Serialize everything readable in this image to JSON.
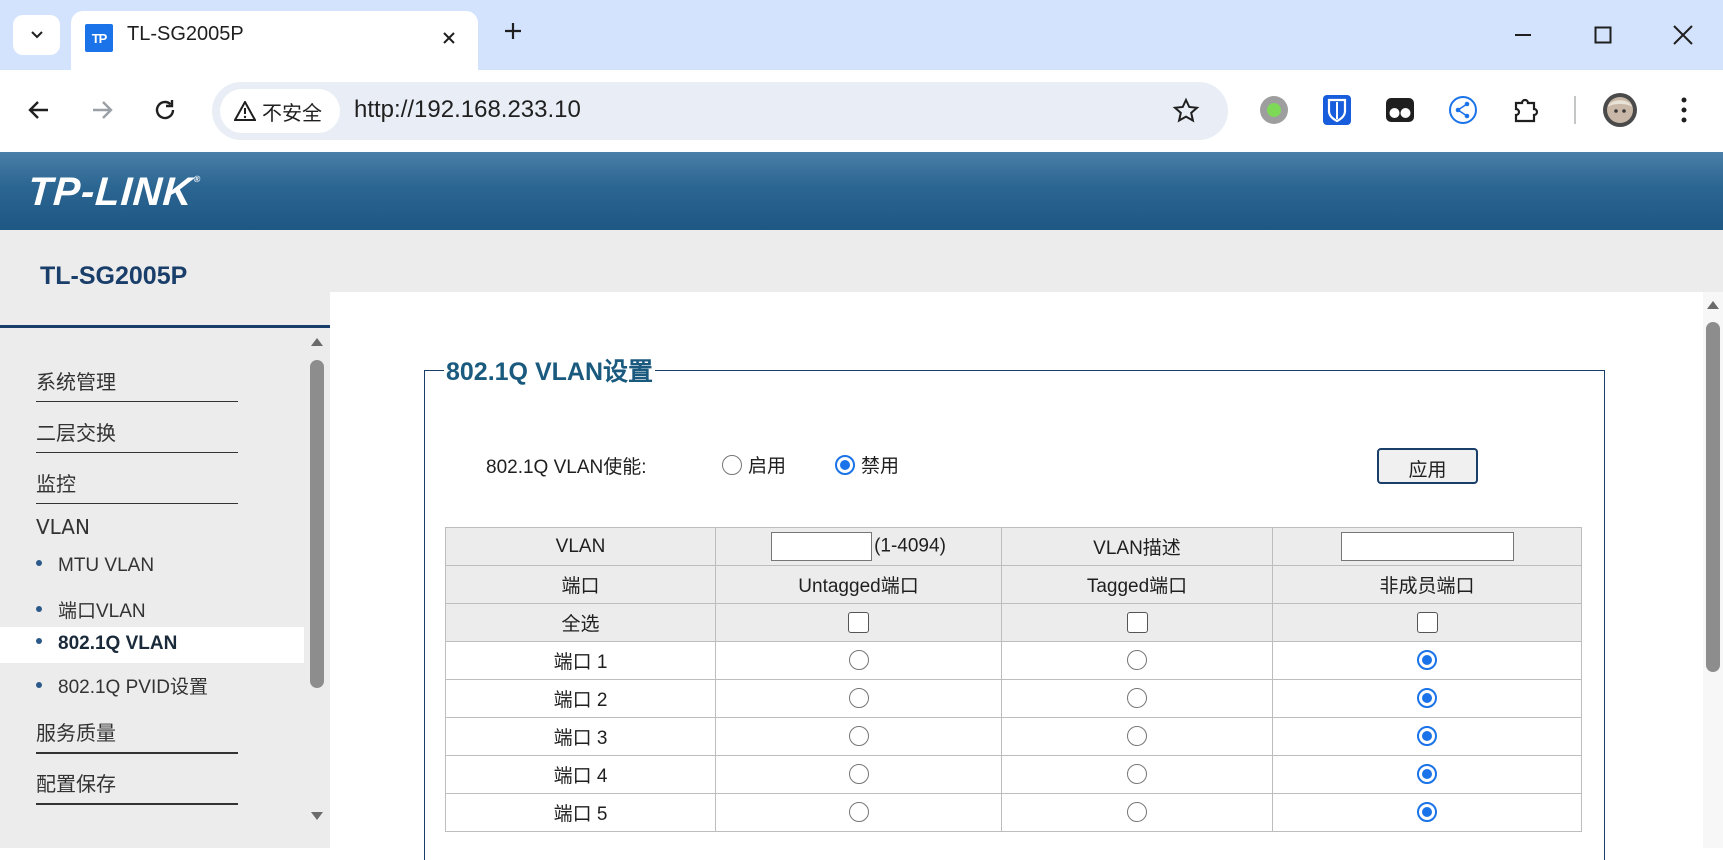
{
  "browser": {
    "tab_title": "TL-SG2005P",
    "favicon_text": "TP",
    "security_label": "不安全",
    "url": "http://192.168.233.10"
  },
  "page": {
    "logo": "TP-LINK",
    "model": "TL-SG2005P"
  },
  "menu": {
    "items": [
      {
        "label": "系统管理"
      },
      {
        "label": "二层交换"
      },
      {
        "label": "监控"
      },
      {
        "label": "VLAN"
      },
      {
        "label": "服务质量"
      },
      {
        "label": "配置保存"
      }
    ],
    "sub_items": [
      {
        "label": "MTU VLAN"
      },
      {
        "label": "端口VLAN"
      },
      {
        "label": "802.1Q VLAN",
        "active": true
      },
      {
        "label": "802.1Q PVID设置"
      }
    ]
  },
  "vlan_settings": {
    "title": "802.1Q VLAN设置",
    "enable_label": "802.1Q VLAN使能:",
    "enable_option": "启用",
    "disable_option": "禁用",
    "selected": "禁用",
    "apply_label": "应用",
    "table": {
      "vlan_label": "VLAN",
      "vlan_range": "(1-4094)",
      "vlan_id_value": "",
      "desc_label": "VLAN描述",
      "desc_value": "",
      "headers": [
        "端口",
        "Untagged端口",
        "Tagged端口",
        "非成员端口"
      ],
      "select_all": "全选",
      "ports": [
        {
          "name": "端口 1",
          "membership": "非成员端口"
        },
        {
          "name": "端口 2",
          "membership": "非成员端口"
        },
        {
          "name": "端口 3",
          "membership": "非成员端口"
        },
        {
          "name": "端口 4",
          "membership": "非成员端口"
        },
        {
          "name": "端口 5",
          "membership": "非成员端口"
        }
      ]
    }
  },
  "colors": {
    "header_blue": "#2b6591",
    "accent_blue": "#1a73e8",
    "title_teal": "#1a5a7e"
  }
}
